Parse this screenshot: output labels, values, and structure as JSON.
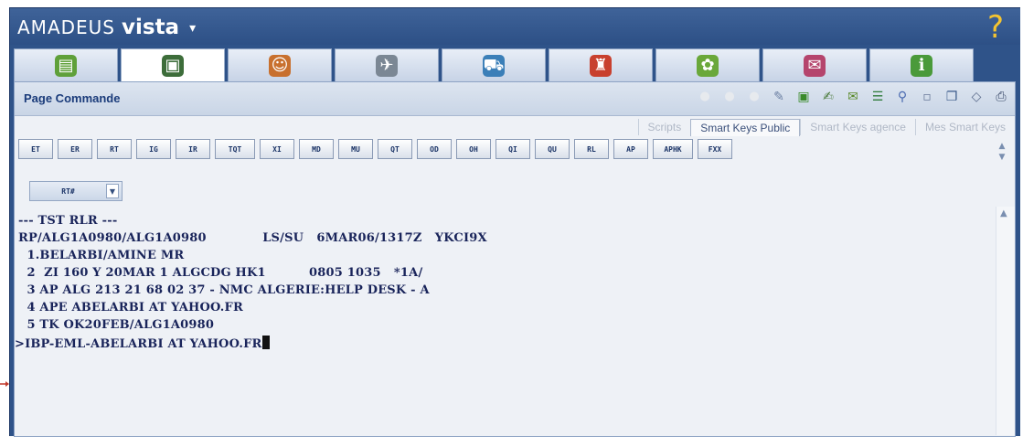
{
  "app": {
    "brand_part1": "AMADEUS",
    "brand_part2": "vista",
    "brand_caret": "▾",
    "help_symbol": "?"
  },
  "tabs": [
    {
      "icon": "book-icon",
      "color": "#5fa03a",
      "active": false
    },
    {
      "icon": "monitor-icon",
      "color": "#3d6d3a",
      "active": true
    },
    {
      "icon": "person-icon",
      "color": "#c8702e",
      "active": false
    },
    {
      "icon": "airplane-icon",
      "color": "#7b8794",
      "active": false
    },
    {
      "icon": "car-icon",
      "color": "#3b7fb8",
      "active": false
    },
    {
      "icon": "hotel-icon",
      "color": "#c8402e",
      "active": false
    },
    {
      "icon": "globe-icon",
      "color": "#6aa83a",
      "active": false
    },
    {
      "icon": "envelope-icon",
      "color": "#b5456d",
      "active": false
    },
    {
      "icon": "info-icon",
      "color": "#4a9a3a",
      "active": false
    }
  ],
  "page": {
    "title": "Page Commande"
  },
  "smart_key_tabs": [
    "Scripts",
    "Smart Keys Public",
    "Smart Keys agence",
    "Mes Smart Keys"
  ],
  "smart_keys": [
    "ET",
    "ER",
    "RT",
    "IG",
    "IR",
    "TQT",
    "XI",
    "MD",
    "MU",
    "QT",
    "OD",
    "OH",
    "QI",
    "QU",
    "RL",
    "AP",
    "APHK",
    "FXX"
  ],
  "rt_select": {
    "value": "RT#"
  },
  "terminal": {
    "lines": [
      "--- TST RLR ---",
      "RP/ALG1A0980/ALG1A0980             LS/SU   6MAR06/1317Z   YKCI9X",
      "  1.BELARBI/AMINE MR",
      "  2  ZI 160 Y 20MAR 1 ALGCDG HK1          0805 1035   *1A/",
      "  3 AP ALG 213 21 68 02 37 - NMC ALGERIE:HELP DESK - A",
      "  4 APE ABELARBI AT YAHOO.FR",
      "  5 TK OK20FEB/ALG1A0980"
    ],
    "input_line": ">IBP-EML-ABELARBI AT YAHOO.FR"
  },
  "colors": {
    "frame": "#2f5389",
    "panel": "#eef1f6",
    "terminal_text": "#19245a",
    "help": "#f4c430",
    "pointer": "#c0392b"
  }
}
